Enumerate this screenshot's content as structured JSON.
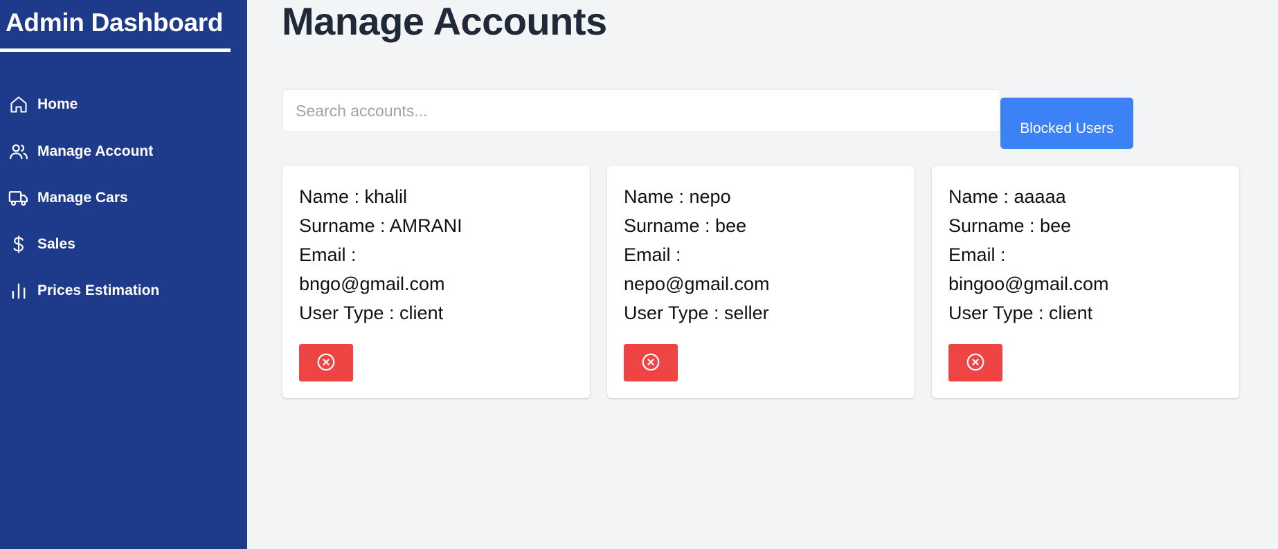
{
  "sidebar": {
    "title": "Admin Dashboard",
    "background": "#1e3a8a",
    "items": [
      {
        "label": "Home",
        "icon": "home-icon"
      },
      {
        "label": "Manage Account",
        "icon": "users-icon"
      },
      {
        "label": "Manage Cars",
        "icon": "truck-icon"
      },
      {
        "label": "Sales",
        "icon": "dollar-icon"
      },
      {
        "label": "Prices Estimation",
        "icon": "bar-chart-icon"
      }
    ]
  },
  "main": {
    "title": "Manage Accounts",
    "search": {
      "placeholder": "Search accounts...",
      "value": ""
    },
    "blocked_button": {
      "label": "Blocked Users",
      "color": "#3b82f6"
    },
    "accounts": [
      {
        "name": "Name : khalil",
        "surname": "Surname : AMRANI",
        "email_label": "Email :",
        "email": "bngo@gmail.com",
        "user_type": "User Type : client"
      },
      {
        "name": "Name : nepo",
        "surname": "Surname : bee",
        "email_label": "Email :",
        "email": "nepo@gmail.com",
        "user_type": "User Type : seller"
      },
      {
        "name": "Name : aaaaa",
        "surname": "Surname : bee",
        "email_label": "Email :",
        "email": "bingoo@gmail.com",
        "user_type": "User Type : client"
      }
    ],
    "delete_button": {
      "icon": "close-circle-icon",
      "color": "#ef4444"
    }
  }
}
